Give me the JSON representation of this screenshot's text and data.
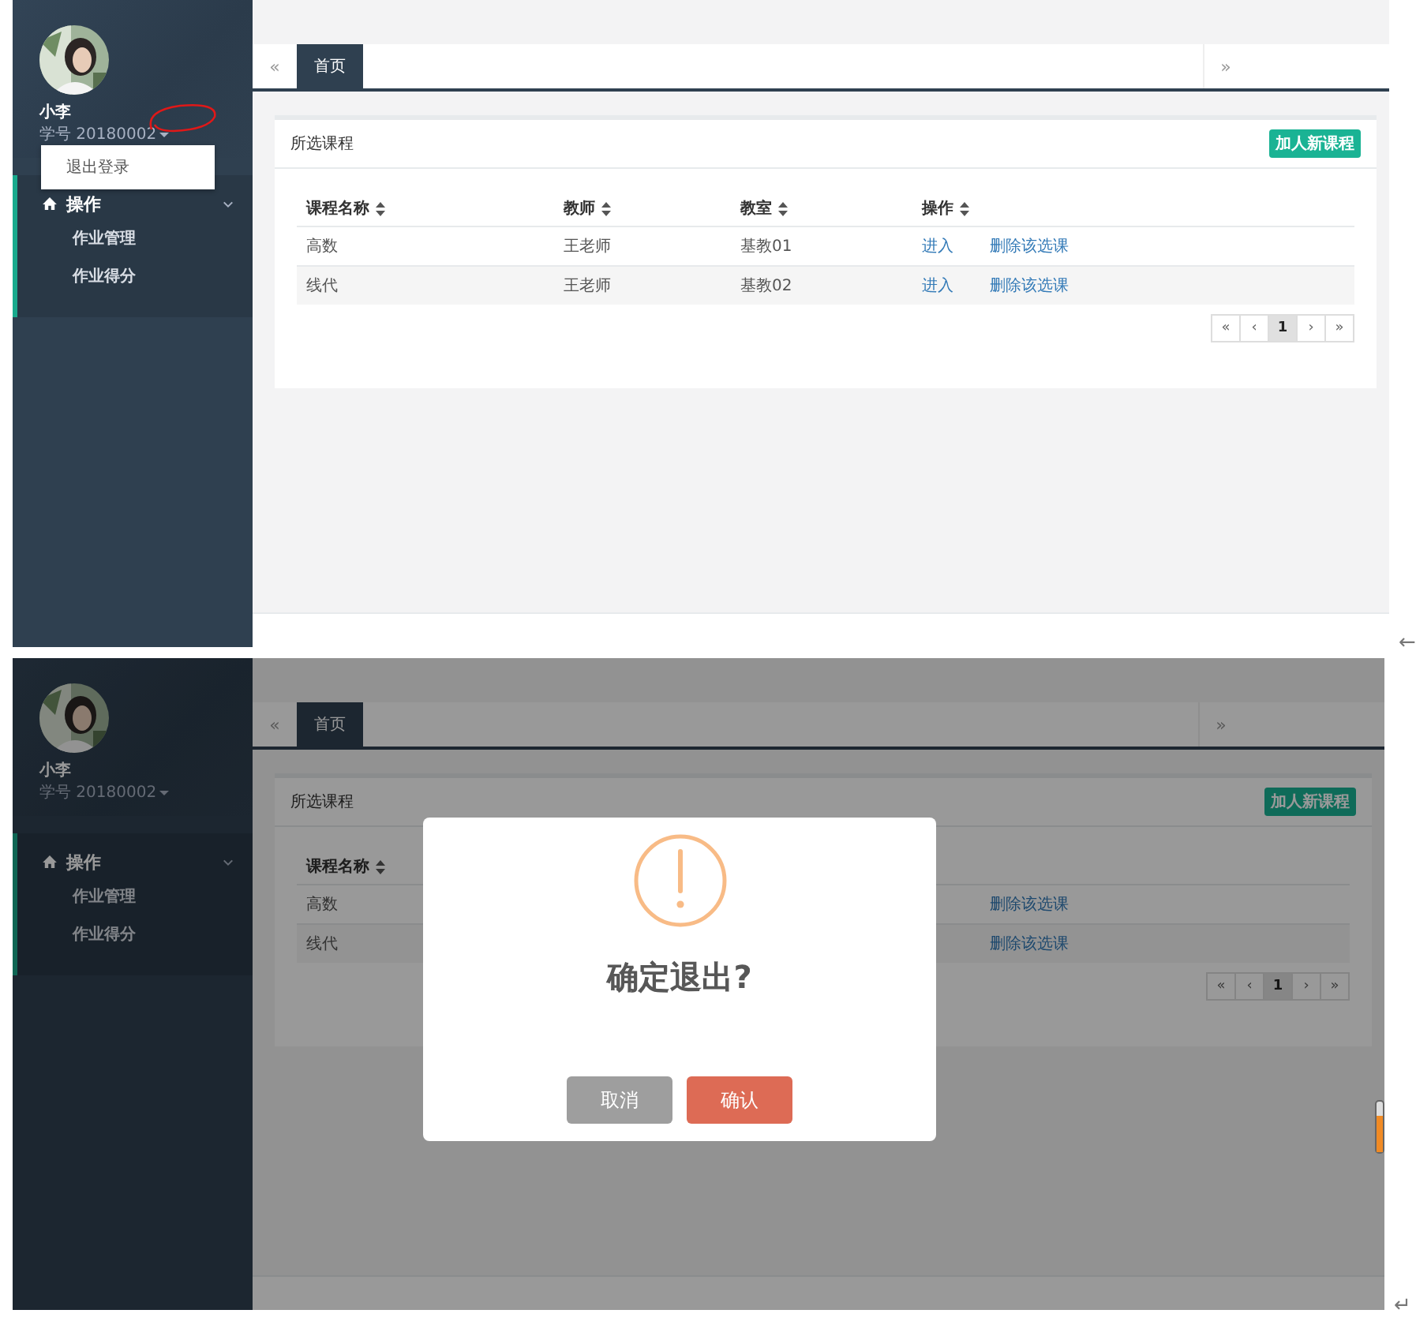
{
  "shots": [
    {
      "user": {
        "name": "小李",
        "id_label": "学号 20180002"
      },
      "user_menu": {
        "items": [
          "退出登录"
        ]
      },
      "annotation": true,
      "nav": {
        "title": "操作",
        "expanded": true,
        "items": [
          "作业管理",
          "作业得分"
        ]
      },
      "tabs": {
        "prev": "«",
        "next": "»",
        "items": [
          {
            "label": "首页",
            "selected": true
          }
        ]
      },
      "panel": {
        "title": "所选课程",
        "add_button": "加人新课程",
        "columns": [
          "课程名称",
          "教师",
          "教室",
          "操作"
        ],
        "rows": [
          {
            "cells": [
              "高数",
              "王老师",
              "基教01"
            ],
            "actions": {
              "enter": "进入",
              "delete": "删除该选课"
            }
          },
          {
            "cells": [
              "线代",
              "王老师",
              "基教02"
            ],
            "actions": {
              "enter": "进入",
              "delete": "删除该选课"
            }
          }
        ],
        "pagination": [
          {
            "label": "«",
            "selected": false
          },
          {
            "label": "‹",
            "selected": false
          },
          {
            "label": "1",
            "selected": true
          },
          {
            "label": "›",
            "selected": false
          },
          {
            "label": "»",
            "selected": false
          }
        ]
      },
      "end_mark": "←"
    },
    {
      "user": {
        "name": "小李",
        "id_label": "学号 20180002"
      },
      "nav": {
        "title": "操作",
        "expanded": true,
        "items": [
          "作业管理",
          "作业得分"
        ]
      },
      "tabs": {
        "prev": "«",
        "next": "»",
        "items": [
          {
            "label": "首页",
            "selected": true
          }
        ]
      },
      "panel": {
        "title": "所选课程",
        "add_button": "加人新课程",
        "columns": [
          "课程名称",
          null,
          null,
          null
        ],
        "rows": [
          {
            "cells": [
              "高数",
              null,
              null
            ],
            "actions": {
              "delete": "删除该选课"
            }
          },
          {
            "cells": [
              "线代",
              null,
              null
            ],
            "actions": {
              "delete": "删除该选课"
            }
          }
        ],
        "pagination": [
          {
            "label": "«",
            "selected": false
          },
          {
            "label": "‹",
            "selected": false
          },
          {
            "label": "1",
            "selected": true
          },
          {
            "label": "›",
            "selected": false
          },
          {
            "label": "»",
            "selected": false
          }
        ]
      },
      "dialog": {
        "message": "确定退出?",
        "cancel": "取消",
        "confirm": "确认"
      },
      "end_mark": "↵"
    }
  ]
}
